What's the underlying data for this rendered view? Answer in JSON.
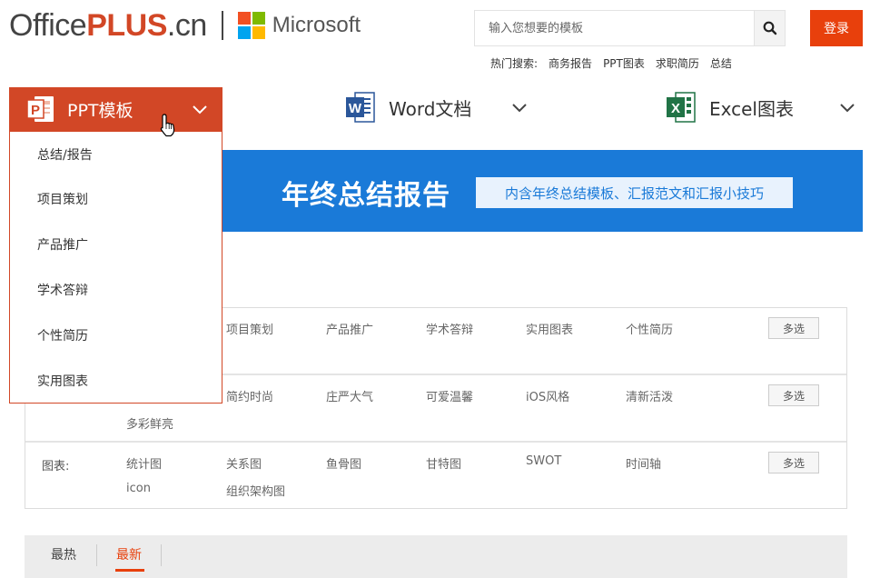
{
  "brand": {
    "office": "Office",
    "plus": "PLUS",
    "cn": ".cn",
    "microsoft": "Microsoft",
    "ms_colors": [
      "#f25022",
      "#7fba00",
      "#00a4ef",
      "#ffb900"
    ]
  },
  "search": {
    "placeholder": "输入您想要的模板",
    "icon": "search-icon"
  },
  "login": {
    "label": "登录"
  },
  "hot_search": {
    "label": "热门搜索:",
    "items": [
      "商务报告",
      "PPT图表",
      "求职简历",
      "总结"
    ]
  },
  "categories": [
    {
      "label": "PPT模板",
      "icon": "powerpoint-icon",
      "color": "#d24726"
    },
    {
      "label": "Word文档",
      "icon": "word-icon",
      "color": "#2b579a"
    },
    {
      "label": "Excel图表",
      "icon": "excel-icon",
      "color": "#217346"
    }
  ],
  "dropdown": {
    "items": [
      "总结/报告",
      "项目策划",
      "产品推广",
      "学术答辩",
      "个性简历",
      "实用图表"
    ]
  },
  "banner": {
    "title": "年终总结报告",
    "subtitle": "内含年终总结模板、汇报范文和汇报小技巧",
    "color": "#1a7ad8"
  },
  "filters": {
    "row1": [
      "项目策划",
      "产品推广",
      "学术答辩",
      "实用图表",
      "个性简历"
    ],
    "row2": [
      "简约时尚",
      "庄严大气",
      "可爱温馨",
      "iOS风格",
      "清新活泼",
      "多彩鲜亮"
    ],
    "row3_label": "图表:",
    "row3": [
      "统计图",
      "关系图",
      "鱼骨图",
      "甘特图",
      "SWOT",
      "时间轴",
      "icon",
      "组织架构图"
    ],
    "multi_label": "多选"
  },
  "tabs": {
    "items": [
      "最热",
      "最新"
    ],
    "active": "最新",
    "accent": "#e8400c"
  }
}
